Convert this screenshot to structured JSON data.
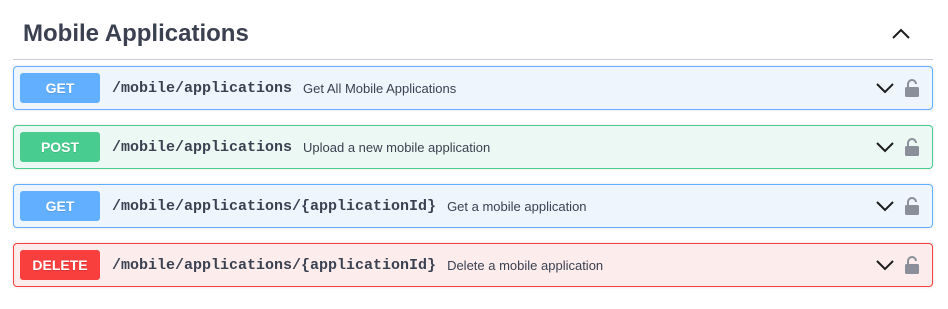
{
  "section": {
    "title": "Mobile Applications",
    "collapse_icon": "chevron-up-icon"
  },
  "operations": [
    {
      "method": "GET",
      "path": "/mobile/applications",
      "summary": "Get All Mobile Applications"
    },
    {
      "method": "POST",
      "path": "/mobile/applications",
      "summary": "Upload a new mobile application"
    },
    {
      "method": "GET",
      "path": "/mobile/applications/{applicationId}",
      "summary": "Get a mobile application"
    },
    {
      "method": "DELETE",
      "path": "/mobile/applications/{applicationId}",
      "summary": "Delete a mobile application"
    }
  ],
  "icons": {
    "expand": "chevron-down-icon",
    "auth": "lock-icon"
  },
  "colors": {
    "get": "#61affe",
    "get_bg": "#eef5fd",
    "post": "#49cc90",
    "post_bg": "#ecf8f3",
    "delete": "#f93e3e",
    "delete_bg": "#fcecec",
    "text": "#3b4151"
  }
}
